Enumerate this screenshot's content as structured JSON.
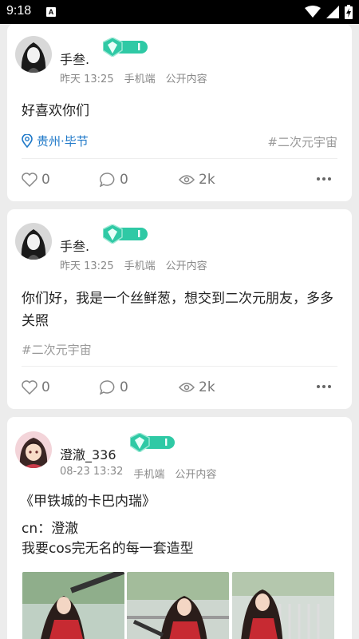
{
  "status_bar": {
    "time": "9:18",
    "notification_badge": "A",
    "icons": [
      "wifi-icon",
      "signal-icon",
      "battery-charging-icon"
    ]
  },
  "posts": [
    {
      "username": "手叁.",
      "level_label": "I",
      "time": "昨天 13:25",
      "device": "手机端",
      "visibility": "公开内容",
      "text": "好喜欢你们",
      "location": "贵州·毕节",
      "topic": "#二次元宇宙",
      "likes": "0",
      "comments": "0",
      "views": "2k"
    },
    {
      "username": "手叁.",
      "level_label": "I",
      "time": "昨天 13:25",
      "device": "手机端",
      "visibility": "公开内容",
      "text": "你们好，我是一个丝鲜葱，想交到二次元朋友，多多关照",
      "topic": "#二次元宇宙",
      "likes": "0",
      "comments": "0",
      "views": "2k"
    },
    {
      "username": "澄澈_336",
      "level_label": "I",
      "time": "08-23 13:32",
      "device": "手机端",
      "visibility": "公开内容",
      "title": "《甲铁城的卡巴内瑞》",
      "text_line1": "cn：澄澈",
      "text_line2": "我要cos完无名的每一套造型"
    }
  ],
  "colors": {
    "accent_blue": "#1e78c8",
    "badge_green": "#2fc9a5",
    "page_bg": "#ececec"
  }
}
